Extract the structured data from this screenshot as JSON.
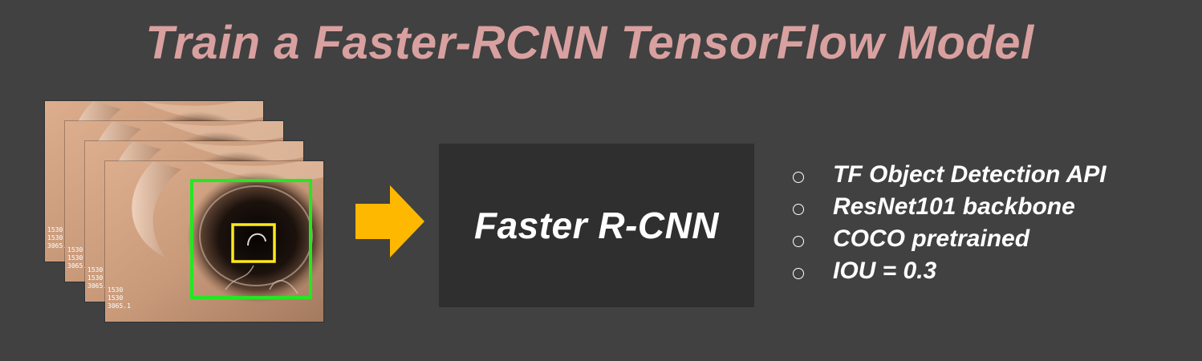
{
  "title": "Train a Faster-RCNN TensorFlow Model",
  "model_box": {
    "label": "Faster R-CNN"
  },
  "bullets": [
    "TF Object Detection API",
    "ResNet101 backbone",
    "COCO pretrained",
    "IOU = 0.3"
  ],
  "frames": {
    "count": 4,
    "overlay_text": "1530\n1530\n3065.1"
  },
  "colors": {
    "background": "#414141",
    "title": "#d9a0a0",
    "arrow": "#ffb800",
    "model_box": "#2f2f2f",
    "outer_box": "#22e822",
    "inner_box": "#ffe81a"
  }
}
